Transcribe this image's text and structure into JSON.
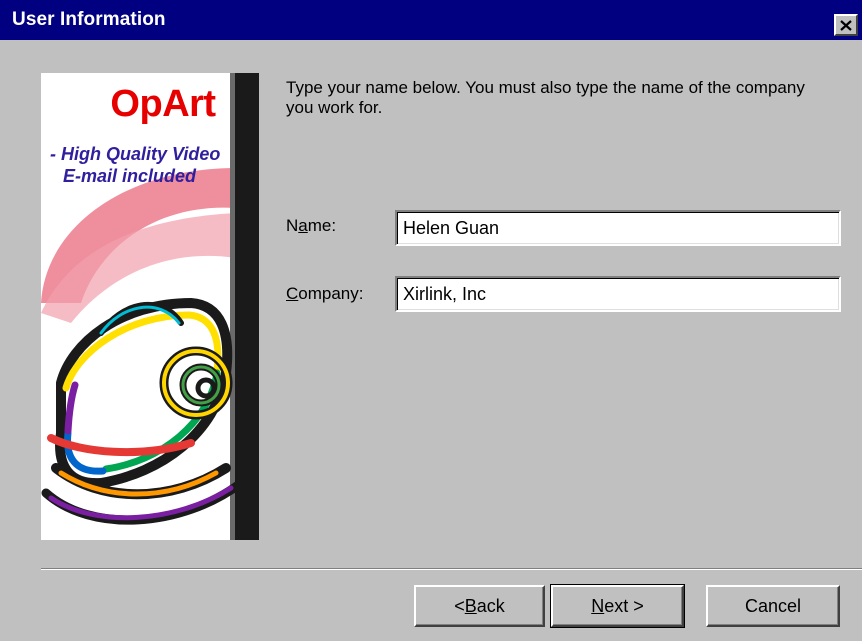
{
  "window": {
    "title": "User Information",
    "close_glyph": "✕"
  },
  "banner": {
    "brand": "OpArt",
    "tagline_line1": "- High Quality Video",
    "tagline_line2": "E-mail included",
    "colors": {
      "brand": "#e60000",
      "tagline": "#2f1f9e",
      "swoosh": "#e8667a",
      "side_stripe": "#1a1a1a"
    },
    "icon": "rainbow-camera-illustration"
  },
  "instructions": "Type your name below. You must also type the name of the company you work for.",
  "fields": {
    "name": {
      "label_pre": "N",
      "label_accel": "a",
      "label_post": "me:",
      "value": "Helen Guan"
    },
    "company": {
      "label_pre": "",
      "label_accel": "C",
      "label_post": "ompany:",
      "value": "Xirlink, Inc"
    }
  },
  "buttons": {
    "back": {
      "pre": "< ",
      "accel": "B",
      "post": "ack"
    },
    "next": {
      "pre": "",
      "accel": "N",
      "post": "ext >"
    },
    "cancel": {
      "label": "Cancel"
    }
  },
  "theme": {
    "titlebar": "#000080",
    "face": "#c0c0c0"
  }
}
